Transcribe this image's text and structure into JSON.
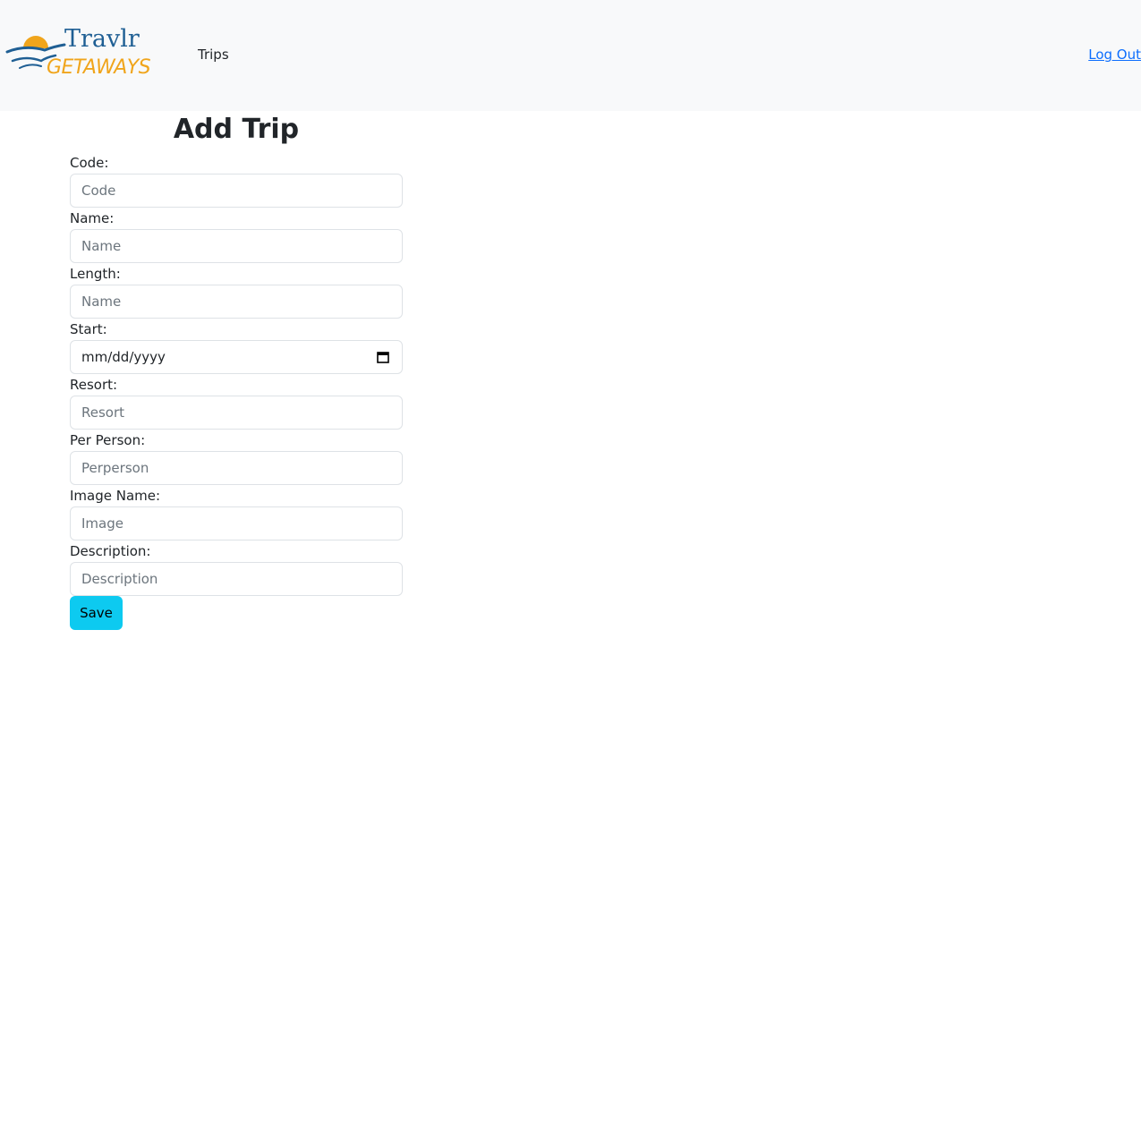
{
  "header": {
    "logo_text_top": "Travlr",
    "logo_text_bottom": "GETAWAYS",
    "nav_trips": "Trips",
    "logout": "Log Out"
  },
  "form": {
    "title": "Add Trip",
    "fields": [
      {
        "label": "Code:",
        "placeholder": "Code",
        "value": ""
      },
      {
        "label": "Name:",
        "placeholder": "Name",
        "value": ""
      },
      {
        "label": "Length:",
        "placeholder": "Name",
        "value": ""
      },
      {
        "label": "Start:",
        "placeholder": "mm/dd/yyyy",
        "value": ""
      },
      {
        "label": "Resort:",
        "placeholder": "Resort",
        "value": ""
      },
      {
        "label": "Per Person:",
        "placeholder": "Perperson",
        "value": ""
      },
      {
        "label": "Image Name:",
        "placeholder": "Image",
        "value": ""
      },
      {
        "label": "Description:",
        "placeholder": "Description",
        "value": ""
      }
    ],
    "save_label": "Save"
  },
  "colors": {
    "navbar_bg": "#f8f9fa",
    "link": "#0d6efd",
    "save_button": "#0dcaf0",
    "logo_blue": "#1f5f94",
    "logo_orange": "#f0a51c"
  },
  "icons": {
    "date_picker": "calendar-icon"
  }
}
